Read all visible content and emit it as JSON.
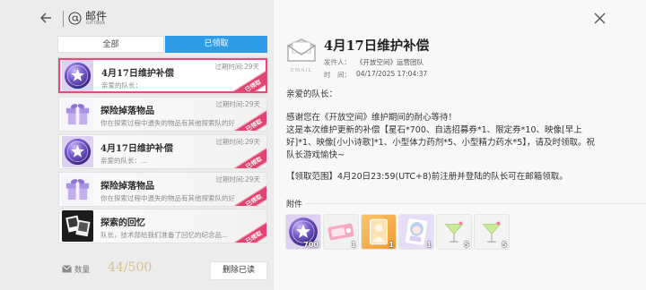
{
  "header": {
    "title": "邮件",
    "subtitle": "GIFTBOX"
  },
  "tabs": [
    {
      "label": "全部",
      "active": false
    },
    {
      "label": "已领取",
      "active": true
    }
  ],
  "mail_list": [
    {
      "icon": "star-orb-icon",
      "title": "4月17日维护补偿",
      "expire": "过期时间:29天",
      "preview": "亲爱的队长：",
      "stamp": "已领取",
      "selected": true
    },
    {
      "icon": "gift-box-icon",
      "title": "探险掉落物品",
      "expire": "过期时间:29天",
      "preview": "你在探索过程中遗失的物品有其他探索队的好",
      "stamp": "已领取",
      "selected": false
    },
    {
      "icon": "star-orb-icon",
      "title": "4月17日维护补偿",
      "expire": "过期时间:29天",
      "preview": "亲爱的队长：...",
      "stamp": "已领取",
      "selected": false
    },
    {
      "icon": "gift-box-icon",
      "title": "探险掉落物品",
      "expire": "过期时间:29天",
      "preview": "你在探索过程中遗失的物品有其他探索队的好",
      "stamp": "已领取",
      "selected": false
    },
    {
      "icon": "memory-photo-icon",
      "title": "探索的回忆",
      "preview": "队长，技术部给我们准备了回忆的纪念品...",
      "stamp": "已领取",
      "selected": false
    }
  ],
  "footer": {
    "count_label": "数量",
    "count": "44/500",
    "delete_label": "删除已读"
  },
  "detail": {
    "envelope_caption": "EMAIL",
    "title": "4月17日维护补偿",
    "sender_label": "发件人：",
    "sender": "《开放空间》运营团队",
    "time_label": "时　间：",
    "time": "04/17/2025 17:04:37",
    "greeting": "亲爱的队长：",
    "body_lines": [
      "感谢您在《开放空间》维护期间的耐心等待！",
      "这是本次维护更新的补偿【星石*700、自选招募券*1、限定券*10、映像[早上",
      "好]*1、映像[小小诗歌]*1、小型体力药剂*5、小型精力药水*5】，请及时领取。祝",
      "队长游戏愉快~"
    ],
    "range_note": "【领取范围】4月20日23:59(UTC+8)前注册并登陆的队长可在邮箱领取。",
    "attachments_label": "附件",
    "attachments": [
      {
        "icon": "star-orb-icon",
        "count": "700"
      },
      {
        "icon": "pink-ticket-icon",
        "count": "1"
      },
      {
        "icon": "orange-card-icon",
        "count": "1"
      },
      {
        "icon": "portrait-card-icon",
        "count": "1"
      },
      {
        "icon": "cocktail-potion-icon",
        "count": "5"
      },
      {
        "icon": "cocktail-potion-icon",
        "count": "5"
      }
    ]
  },
  "colors": {
    "accent": "#2f9ce8",
    "stamp": "#e2436f",
    "selected_border": "#e54b78",
    "count_gold": "#d6c08e"
  }
}
